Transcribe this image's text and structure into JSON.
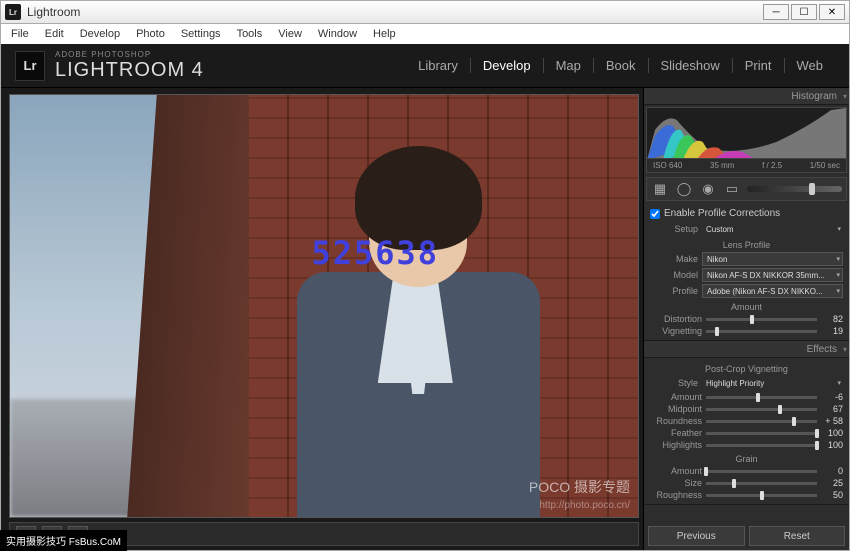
{
  "window": {
    "title": "Lightroom"
  },
  "menu": [
    "File",
    "Edit",
    "Develop",
    "Photo",
    "Settings",
    "Tools",
    "View",
    "Window",
    "Help"
  ],
  "brand": {
    "sub": "ADOBE PHOTOSHOP",
    "main": "LIGHTROOM 4"
  },
  "modules": [
    "Library",
    "Develop",
    "Map",
    "Book",
    "Slideshow",
    "Print",
    "Web"
  ],
  "active_module": "Develop",
  "histogram": {
    "title": "Histogram",
    "meta": {
      "iso": "ISO 640",
      "focal": "35 mm",
      "aperture": "f / 2.5",
      "shutter": "1/50 sec"
    }
  },
  "lens": {
    "enable_label": "Enable Profile Corrections",
    "setup_label": "Setup",
    "setup_value": "Custom",
    "header": "Lens Profile",
    "make_label": "Make",
    "make_value": "Nikon",
    "model_label": "Model",
    "model_value": "Nikon AF-S DX NIKKOR 35mm...",
    "profile_label": "Profile",
    "profile_value": "Adobe (Nikon AF-S DX NIKKO...",
    "amount_header": "Amount",
    "distortion_label": "Distortion",
    "distortion_value": 82,
    "vignetting_label": "Vignetting",
    "vignetting_value": 19
  },
  "effects": {
    "title": "Effects",
    "pcv_header": "Post-Crop Vignetting",
    "style_label": "Style",
    "style_value": "Highlight Priority",
    "amount_label": "Amount",
    "amount_value": -6,
    "midpoint_label": "Midpoint",
    "midpoint_value": 67,
    "roundness_label": "Roundness",
    "roundness_value": 58,
    "roundness_display": "+ 58",
    "feather_label": "Feather",
    "feather_value": 100,
    "highlights_label": "Highlights",
    "highlights_value": 100,
    "grain_header": "Grain",
    "grain_amount_label": "Amount",
    "grain_amount_value": 0,
    "grain_size_label": "Size",
    "grain_size_value": 25,
    "grain_roughness_label": "Roughness",
    "grain_roughness_value": 50
  },
  "buttons": {
    "previous": "Previous",
    "reset": "Reset"
  },
  "watermarks": {
    "num": "525638",
    "poco": "POCO 摄影专题",
    "url": "http://photo.poco.cn/"
  },
  "footer_badge": "实用摄影技巧 FsBus.CoM"
}
